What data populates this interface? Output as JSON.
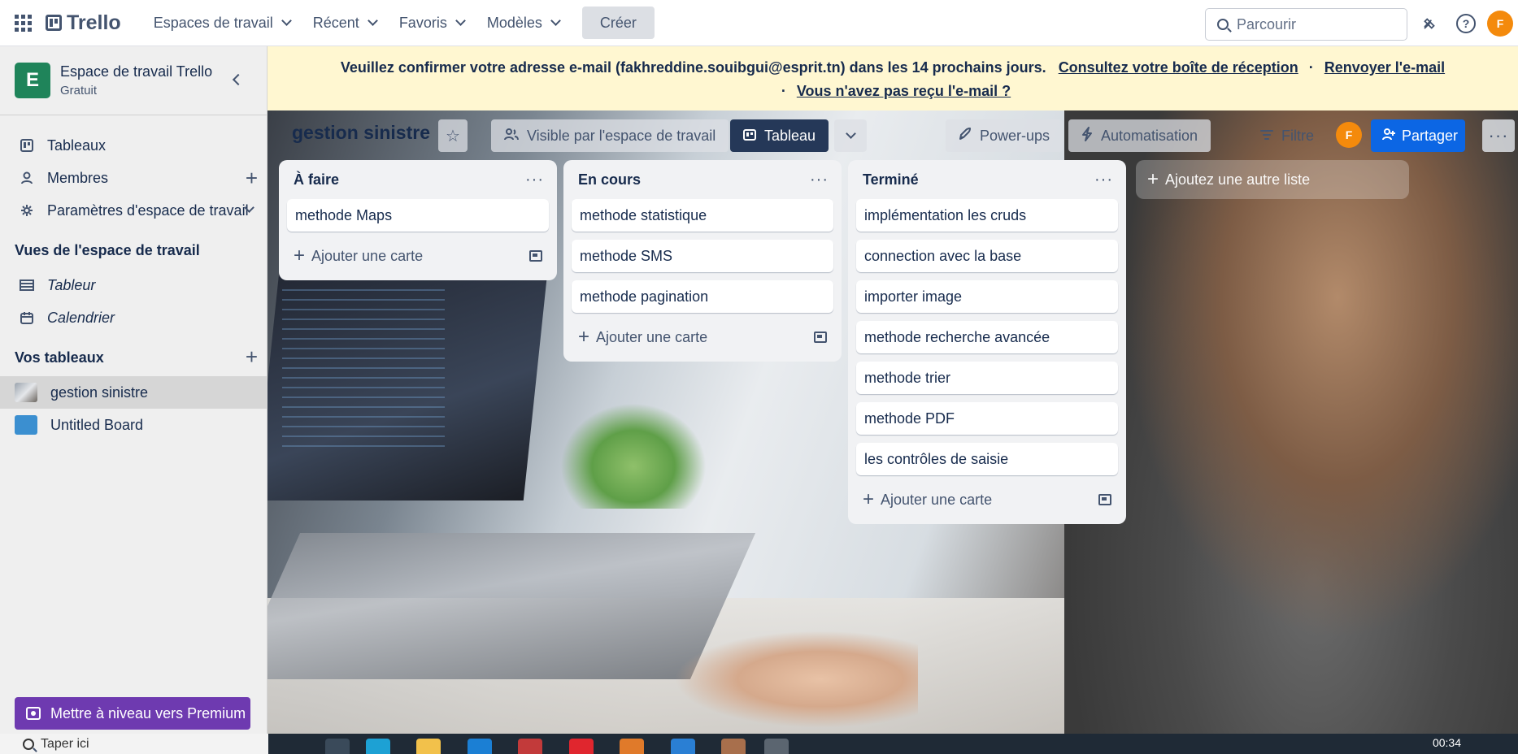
{
  "header": {
    "logo": "Trello",
    "nav": [
      {
        "label": "Espaces de travail"
      },
      {
        "label": "Récent"
      },
      {
        "label": "Favoris"
      },
      {
        "label": "Modèles"
      }
    ],
    "create_label": "Créer",
    "search_placeholder": "Parcourir",
    "avatar_initial": "F"
  },
  "sidebar": {
    "workspace_initial": "E",
    "workspace_name": "Espace de travail Trello",
    "workspace_plan": "Gratuit",
    "items": [
      {
        "label": "Tableaux"
      },
      {
        "label": "Membres"
      },
      {
        "label": "Paramètres d'espace de travail"
      }
    ],
    "views_title": "Vues de l'espace de travail",
    "views": [
      {
        "label": "Tableur"
      },
      {
        "label": "Calendrier"
      }
    ],
    "boards_title": "Vos tableaux",
    "boards": [
      {
        "label": "gestion sinistre"
      },
      {
        "label": "Untitled Board"
      }
    ],
    "premium_label": "Mettre à niveau vers Premium"
  },
  "banner": {
    "message": "Veuillez confirmer votre adresse e-mail (fakhreddine.souibgui@esprit.tn) dans les 14 prochains jours.",
    "inbox_link": "Consultez votre boîte de réception",
    "resend_link": "Renvoyer l'e-mail",
    "not_received_link": "Vous n'avez pas reçu l'e-mail ?",
    "separator": "·"
  },
  "board": {
    "title": "gestion sinistre",
    "visibility_label": "Visible par l'espace de travail",
    "view_label": "Tableau",
    "powerups_label": "Power-ups",
    "automation_label": "Automatisation",
    "filter_label": "Filtre",
    "member_initial": "F",
    "share_label": "Partager",
    "add_list_label": "Ajoutez une autre liste",
    "add_card_label": "Ajouter une carte",
    "lists": [
      {
        "title": "À faire",
        "cards": [
          "methode Maps"
        ]
      },
      {
        "title": "En cours",
        "cards": [
          "methode statistique",
          "methode SMS",
          "methode pagination"
        ]
      },
      {
        "title": "Terminé",
        "cards": [
          "implémentation les cruds",
          "connection avec la base",
          "importer image",
          "methode recherche avancée",
          "methode trier",
          "methode PDF",
          "les contrôles de saisie"
        ]
      }
    ]
  },
  "taskbar": {
    "search_text": "Taper ici",
    "clock": "00:34"
  },
  "colors": {
    "workspace_logo": "#1f845a",
    "premium": "#6e3ab0",
    "share": "#0c66e4",
    "avatar": "#f48a0c",
    "banner_bg": "#fff7d1",
    "view_button": "#253858"
  }
}
